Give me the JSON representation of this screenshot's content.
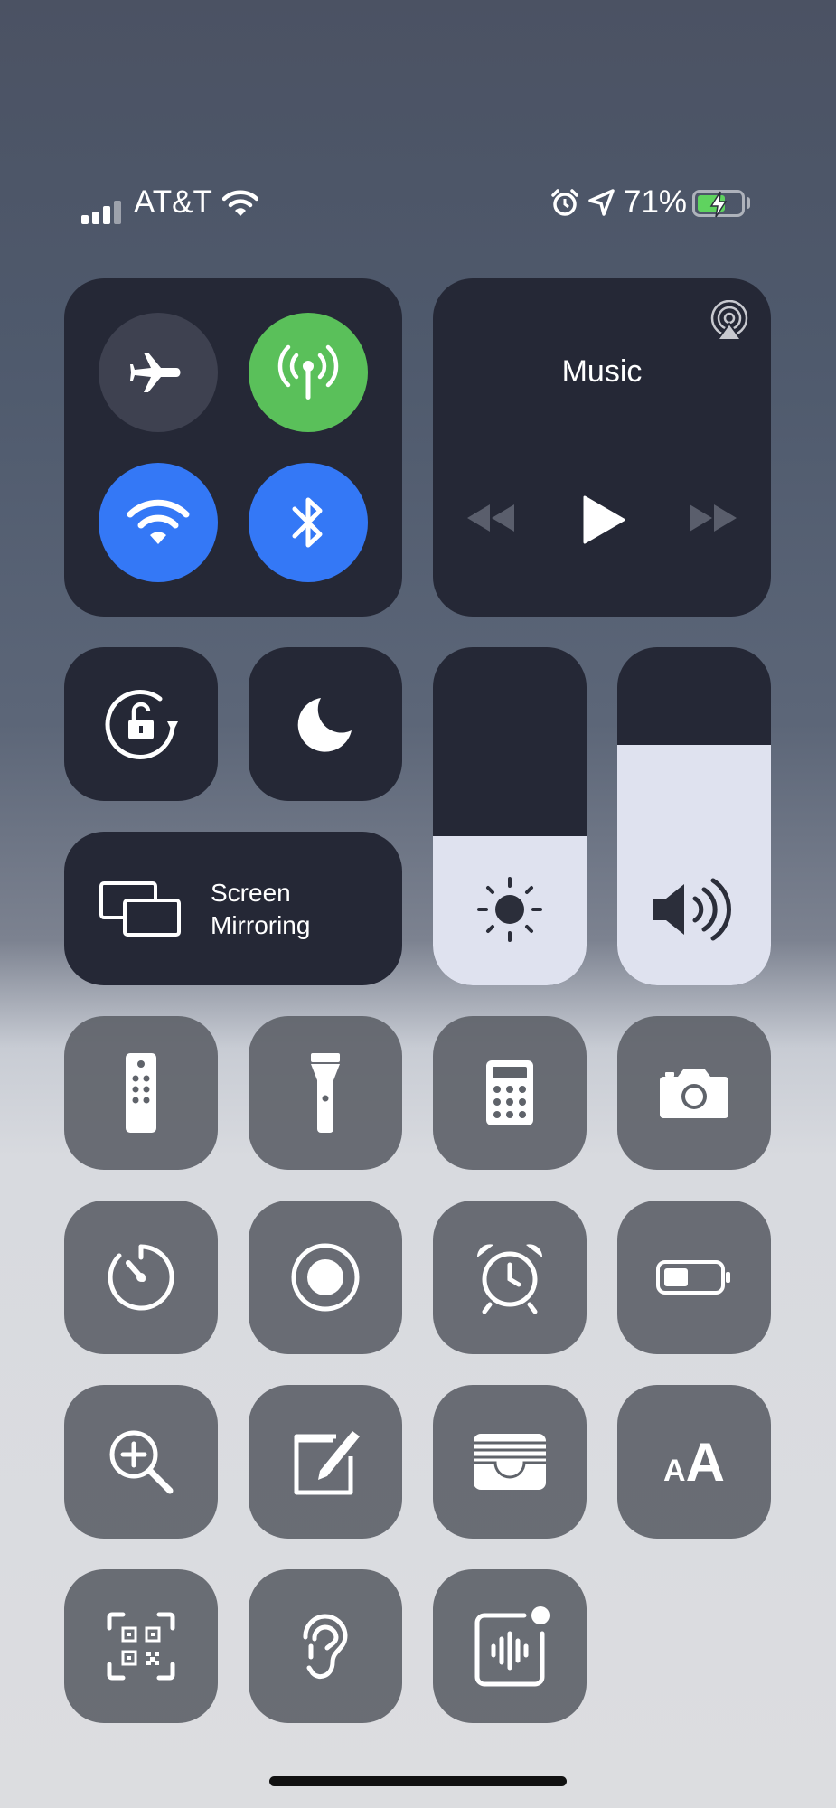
{
  "status_bar": {
    "carrier": "AT&T",
    "battery_percent": "71%",
    "battery_level": 0.71,
    "icons": [
      "signal-icon",
      "wifi-icon",
      "alarm-icon",
      "location-icon",
      "battery-charging-icon"
    ]
  },
  "connectivity": {
    "airplane": {
      "icon": "airplane-icon",
      "active": false
    },
    "cellular": {
      "icon": "cellular-antenna-icon",
      "active": true,
      "color": "#5ac05a"
    },
    "wifi": {
      "icon": "wifi-icon",
      "active": true,
      "color": "#3478f6"
    },
    "bluetooth": {
      "icon": "bluetooth-icon",
      "active": true,
      "color": "#3478f6"
    }
  },
  "music": {
    "title": "Music",
    "icons": [
      "airplay-icon",
      "rewind-icon",
      "play-icon",
      "fast-forward-icon"
    ]
  },
  "screen_mirroring": {
    "line1": "Screen",
    "line2": "Mirroring"
  },
  "sliders": {
    "brightness_level": 0.44,
    "volume_level": 0.71
  },
  "controls": [
    "apple-tv-remote-icon",
    "flashlight-icon",
    "calculator-icon",
    "camera-icon",
    "timer-icon",
    "screen-record-icon",
    "alarm-clock-icon",
    "low-power-mode-icon",
    "magnifier-icon",
    "notes-icon",
    "wallet-icon",
    "text-size-icon",
    "qr-code-scanner-icon",
    "hearing-icon",
    "voice-memos-icon"
  ],
  "text_size_label": "AA"
}
